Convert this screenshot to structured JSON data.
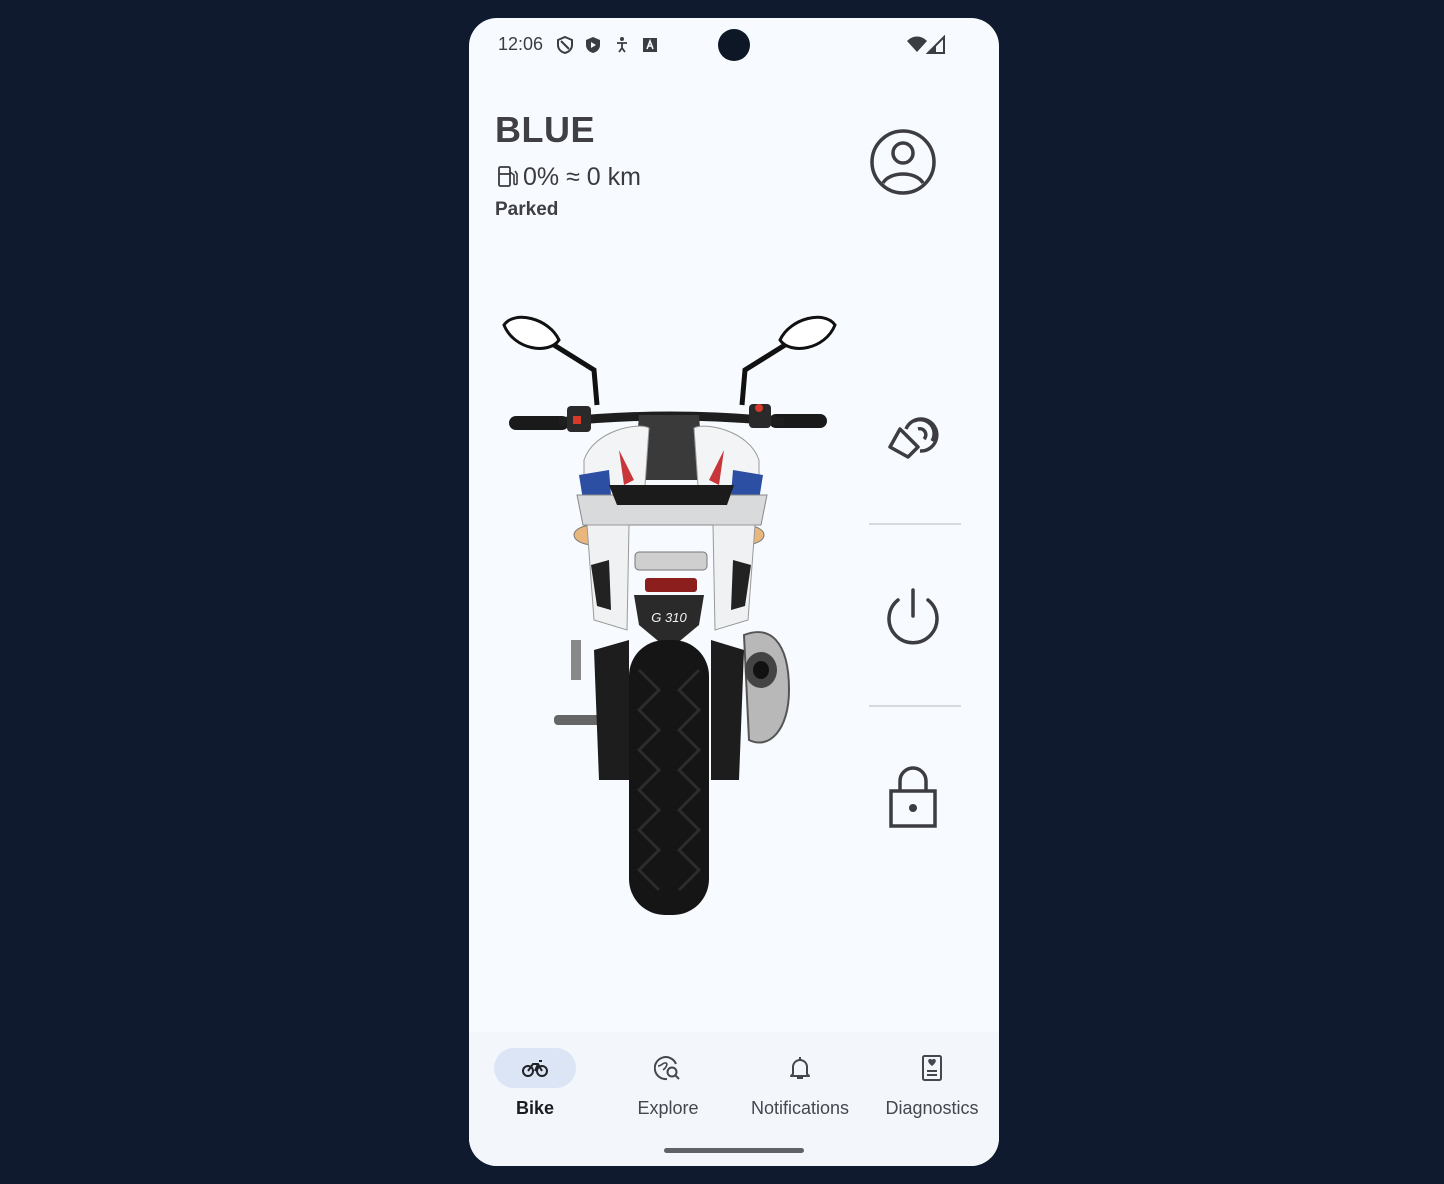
{
  "status_bar": {
    "time": "12:06",
    "icons": [
      "shield-outline-icon",
      "shield-play-icon",
      "accessibility-icon",
      "a-box-icon",
      "wifi-icon",
      "cell-signal-icon"
    ]
  },
  "bike": {
    "name": "BLUE",
    "fuel_text": "0% ≈ 0 km",
    "fuel_icon": "fuel-pump-icon",
    "state": "Parked",
    "model_badge": "G 310"
  },
  "header": {
    "profile_icon": "account-circle-icon"
  },
  "controls": [
    {
      "icon": "locate-bike-icon"
    },
    {
      "icon": "power-icon"
    },
    {
      "icon": "lock-icon"
    }
  ],
  "nav": {
    "items": [
      {
        "label": "Bike",
        "icon": "motorcycle-icon",
        "active": true
      },
      {
        "label": "Explore",
        "icon": "globe-search-icon",
        "active": false
      },
      {
        "label": "Notifications",
        "icon": "bell-icon",
        "active": false
      },
      {
        "label": "Diagnostics",
        "icon": "diagnostics-icon",
        "active": false
      }
    ]
  },
  "colors": {
    "background": "#101a2e",
    "screen": "#f7fbff",
    "active_pill": "#dbe5f6",
    "text": "#3f3f44"
  }
}
